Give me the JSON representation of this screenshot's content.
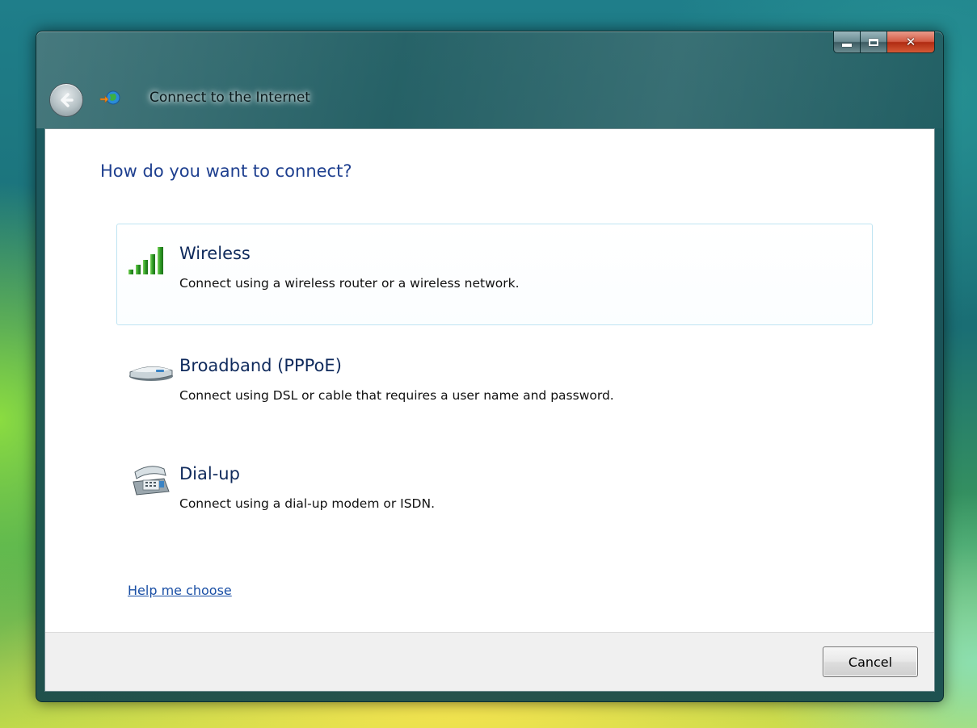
{
  "window": {
    "title": "Connect to the Internet",
    "caption_buttons": {
      "minimize": "minimize-icon",
      "maximize": "maximize-icon",
      "close": "close-icon"
    }
  },
  "page": {
    "heading": "How do you want to connect?",
    "options": [
      {
        "title": "Wireless",
        "description": "Connect using a wireless router or a wireless network.",
        "icon": "wireless-signal-icon",
        "selected": true
      },
      {
        "title": "Broadband (PPPoE)",
        "description": "Connect using DSL or cable that requires a user name and password.",
        "icon": "broadband-modem-icon",
        "selected": false
      },
      {
        "title": "Dial-up",
        "description": "Connect using a dial-up modem or ISDN.",
        "icon": "dialup-phone-icon",
        "selected": false
      }
    ],
    "help_link": "Help me choose"
  },
  "footer": {
    "cancel_label": "Cancel"
  },
  "colors": {
    "heading": "#1e3f8f",
    "selection_border": "#bfe4f2",
    "link": "#1a4fa5"
  }
}
